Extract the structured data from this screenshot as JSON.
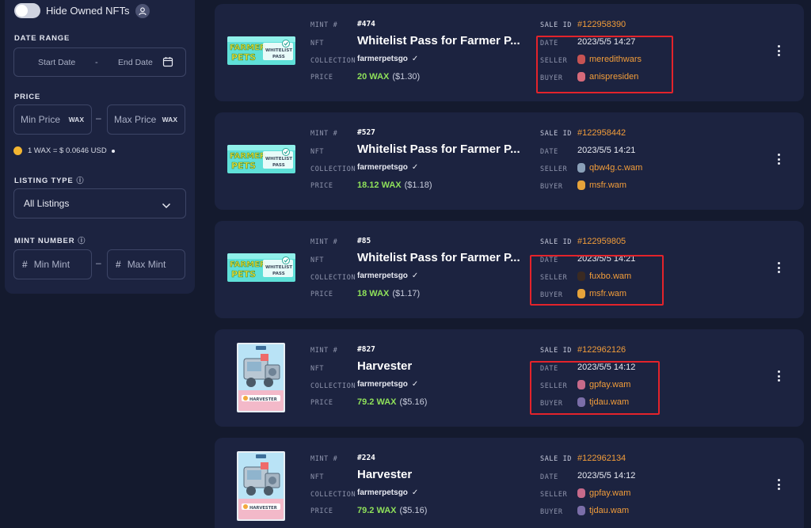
{
  "sidebar": {
    "hide_owned_label": "Hide Owned NFTs",
    "date_range": {
      "label": "DATE RANGE",
      "start_placeholder": "Start Date",
      "separator": "-",
      "end_placeholder": "End Date"
    },
    "price": {
      "label": "PRICE",
      "min_placeholder": "Min Price",
      "max_placeholder": "Max Price",
      "currency": "WAX",
      "separator": "–",
      "rate": "1 WAX = $ 0.0646 USD"
    },
    "listing_type": {
      "label": "LISTING TYPE",
      "info_icon": "ⓘ",
      "selected": "All Listings"
    },
    "mint_number": {
      "label": "MINT NUMBER",
      "info_icon": "ⓘ",
      "min_placeholder": "Min Mint",
      "max_placeholder": "Max Mint",
      "hash": "#",
      "separator": "–"
    }
  },
  "labels": {
    "mint": "MINT #",
    "nft": "NFT",
    "collection": "COLLECTION",
    "price": "PRICE",
    "sale_id": "SALE ID",
    "date": "DATE",
    "seller": "SELLER",
    "buyer": "BUYER"
  },
  "sales": [
    {
      "mint": "#474",
      "name": "Whitelist Pass for Farmer P...",
      "collection": "farmerpetsgo",
      "price_wax": "20 WAX",
      "price_usd": "($1.30)",
      "sale_id": "#122958390",
      "date": "2023/5/5 14:27",
      "seller": "meredithwars",
      "buyer": "anispresiden",
      "image": "whitelist-pass",
      "highlighted": true
    },
    {
      "mint": "#527",
      "name": "Whitelist Pass for Farmer P...",
      "collection": "farmerpetsgo",
      "price_wax": "18.12 WAX",
      "price_usd": "($1.18)",
      "sale_id": "#122958442",
      "date": "2023/5/5 14:21",
      "seller": "qbw4g.c.wam",
      "buyer": "msfr.wam",
      "image": "whitelist-pass",
      "highlighted": false
    },
    {
      "mint": "#85",
      "name": "Whitelist Pass for Farmer P...",
      "collection": "farmerpetsgo",
      "price_wax": "18 WAX",
      "price_usd": "($1.17)",
      "sale_id": "#122959805",
      "date": "2023/5/5 14:21",
      "seller": "fuxbo.wam",
      "buyer": "msfr.wam",
      "image": "whitelist-pass",
      "highlighted": true
    },
    {
      "mint": "#827",
      "name": "Harvester",
      "collection": "farmerpetsgo",
      "price_wax": "79.2 WAX",
      "price_usd": "($5.16)",
      "sale_id": "#122962126",
      "date": "2023/5/5 14:12",
      "seller": "gpfay.wam",
      "buyer": "tjdau.wam",
      "image": "harvester-card",
      "highlighted": true
    },
    {
      "mint": "#224",
      "name": "Harvester",
      "collection": "farmerpetsgo",
      "price_wax": "79.2 WAX",
      "price_usd": "($5.16)",
      "sale_id": "#122962134",
      "date": "2023/5/5 14:12",
      "seller": "gpfay.wam",
      "buyer": "tjdau.wam",
      "image": "harvester-card",
      "highlighted": false
    }
  ],
  "colors": {
    "background": "#141a2e",
    "card": "#1c2340",
    "price_green": "#8fe15a",
    "link_orange": "#f29d3a",
    "highlight_red": "#e3232b"
  },
  "image_text": {
    "pass_logo": "FARMER PETS",
    "pass_label": "WHITELIST PASS",
    "harvester_banner": "HARVESTER"
  }
}
